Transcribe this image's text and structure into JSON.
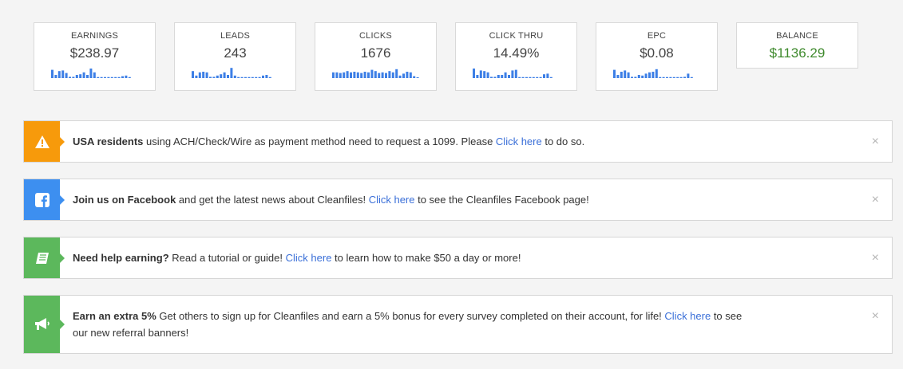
{
  "stats": [
    {
      "label": "EARNINGS",
      "value": "$238.97",
      "spark": [
        0.65,
        0.25,
        0.55,
        0.6,
        0.4,
        0.1,
        0.1,
        0.25,
        0.3,
        0.45,
        0.25,
        0.75,
        0.45,
        0.08,
        0.08,
        0.08,
        0.08,
        0.08,
        0.08,
        0.08,
        0.15,
        0.2,
        0.08
      ]
    },
    {
      "label": "LEADS",
      "value": "243",
      "spark": [
        0.55,
        0.2,
        0.45,
        0.5,
        0.45,
        0.1,
        0.1,
        0.2,
        0.3,
        0.45,
        0.25,
        0.8,
        0.2,
        0.08,
        0.08,
        0.08,
        0.08,
        0.08,
        0.08,
        0.08,
        0.2,
        0.25,
        0.08
      ]
    },
    {
      "label": "CLICKS",
      "value": "1676",
      "spark": [
        0.45,
        0.45,
        0.4,
        0.45,
        0.55,
        0.45,
        0.5,
        0.45,
        0.4,
        0.5,
        0.45,
        0.65,
        0.55,
        0.4,
        0.45,
        0.4,
        0.55,
        0.45,
        0.7,
        0.2,
        0.35,
        0.5,
        0.45,
        0.15,
        0.05
      ]
    },
    {
      "label": "CLICK THRU",
      "value": "14.49%",
      "spark": [
        0.75,
        0.25,
        0.6,
        0.55,
        0.45,
        0.1,
        0.1,
        0.25,
        0.25,
        0.45,
        0.25,
        0.6,
        0.65,
        0.08,
        0.08,
        0.08,
        0.08,
        0.08,
        0.08,
        0.08,
        0.3,
        0.35,
        0.08
      ]
    },
    {
      "label": "EPC",
      "value": "$0.08",
      "spark": [
        0.65,
        0.25,
        0.5,
        0.6,
        0.45,
        0.1,
        0.1,
        0.25,
        0.2,
        0.35,
        0.45,
        0.5,
        0.7,
        0.08,
        0.08,
        0.08,
        0.08,
        0.08,
        0.08,
        0.08,
        0.1,
        0.35,
        0.08
      ]
    },
    {
      "label": "BALANCE",
      "value": "$1136.29"
    }
  ],
  "alerts": [
    {
      "icon": "warning-icon",
      "color": "#f79a0b",
      "bold": "USA residents",
      "text": " using ACH/Check/Wire as payment method need to request a 1099. Please ",
      "link": "Click here",
      "tail": " to do so.",
      "close": "×"
    },
    {
      "icon": "facebook-icon",
      "color": "#3d8ff0",
      "bold": "Join us on Facebook",
      "text": " and get the latest news about Cleanfiles! ",
      "link": "Click here",
      "tail": " to see the Cleanfiles Facebook page!",
      "close": "×"
    },
    {
      "icon": "book-icon",
      "color": "#5cb85c",
      "bold": "Need help earning?",
      "text": " Read a tutorial or guide! ",
      "link": "Click here",
      "tail": " to learn how to make $50 a day or more!",
      "close": "×"
    },
    {
      "icon": "megaphone-icon",
      "color": "#5cb85c",
      "bold": "Earn an extra 5%",
      "text": " Get others to sign up for Cleanfiles and earn a 5% bonus for every survey completed on their account, for life! ",
      "link": "Click here",
      "tail": " to see our new referral banners!",
      "close": "×"
    }
  ]
}
